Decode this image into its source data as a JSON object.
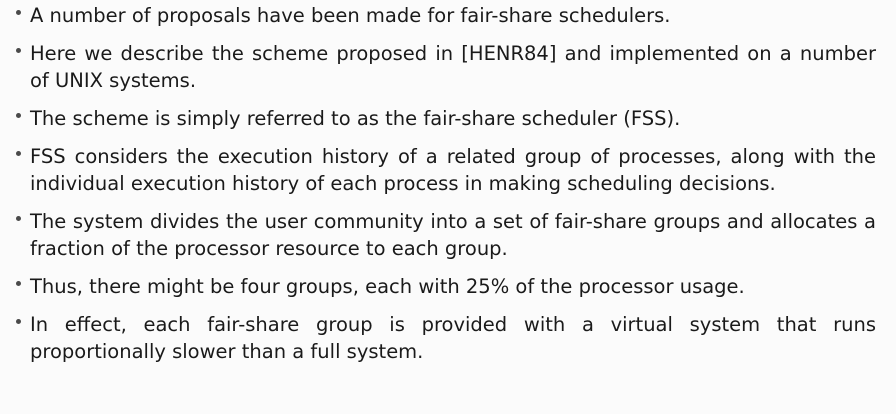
{
  "bullets": [
    {
      "text": "A number of proposals have been made for fair-share schedulers."
    },
    {
      "text": "Here we describe the scheme proposed in [HENR84] and implemented on a number of UNIX systems."
    },
    {
      "text": "The scheme is simply referred to as the fair-share scheduler (FSS)."
    },
    {
      "text": "FSS considers the execution history of a related group of processes, along with the individual execution history of each process in making scheduling decisions."
    },
    {
      "text": "The system divides the user community into a set of fair-share groups and allocates a fraction of the processor resource to each group."
    },
    {
      "text": "Thus, there might be four groups, each with 25% of the processor usage."
    },
    {
      "text": "In effect, each fair-share group is provided with a virtual system that runs proportionally slower than a full system."
    }
  ]
}
